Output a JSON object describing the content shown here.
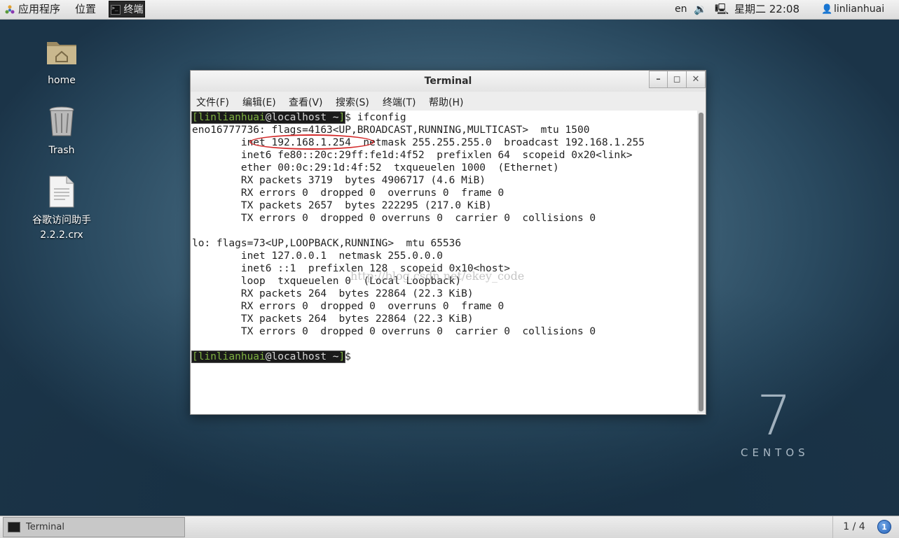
{
  "top_panel": {
    "applications": "应用程序",
    "places": "位置",
    "task_label": "终端",
    "language": "en",
    "clock": "星期二 22:08",
    "user": "linlianhuai",
    "icons": [
      "app-menu-icon",
      "terminal-icon",
      "volume-icon",
      "network-icon",
      "user-icon"
    ]
  },
  "desktop": {
    "icons": [
      {
        "label": "home",
        "icon": "home-folder-icon"
      },
      {
        "label": "Trash",
        "icon": "trash-icon"
      },
      {
        "label": "谷歌访问助手",
        "label2": "2.2.2.crx",
        "icon": "file-icon"
      }
    ],
    "brand_number": "7",
    "brand_name": "CENTOS"
  },
  "window": {
    "title": "Terminal",
    "buttons": [
      "minimize",
      "maximize",
      "close"
    ],
    "menu": [
      "文件(F)",
      "编辑(E)",
      "查看(V)",
      "搜索(S)",
      "终端(T)",
      "帮助(H)"
    ]
  },
  "terminal": {
    "prompt_user": "linlianhuai",
    "prompt_host": "@localhost ~",
    "prompt_command": " ifconfig",
    "lines": [
      "eno16777736: flags=4163<UP,BROADCAST,RUNNING,MULTICAST>  mtu 1500",
      "        inet 192.168.1.254  netmask 255.255.255.0  broadcast 192.168.1.255",
      "        inet6 fe80::20c:29ff:fe1d:4f52  prefixlen 64  scopeid 0x20<link>",
      "        ether 00:0c:29:1d:4f:52  txqueuelen 1000  (Ethernet)",
      "        RX packets 3719  bytes 4906717 (4.6 MiB)",
      "        RX errors 0  dropped 0  overruns 0  frame 0",
      "        TX packets 2657  bytes 222295 (217.0 KiB)",
      "        TX errors 0  dropped 0 overruns 0  carrier 0  collisions 0",
      "",
      "lo: flags=73<UP,LOOPBACK,RUNNING>  mtu 65536",
      "        inet 127.0.0.1  netmask 255.0.0.0",
      "        inet6 ::1  prefixlen 128  scopeid 0x10<host>",
      "        loop  txqueuelen 0  (Local Loopback)",
      "        RX packets 264  bytes 22864 (22.3 KiB)",
      "        RX errors 0  dropped 0  overruns 0  frame 0",
      "        TX packets 264  bytes 22864 (22.3 KiB)",
      "        TX errors 0  dropped 0 overruns 0  carrier 0  collisions 0"
    ],
    "watermark": "http://blog.csdn.net/ekey_code",
    "highlight_color": "#d42a2a"
  },
  "bottom_panel": {
    "task_label": "Terminal",
    "pager": "1 / 4",
    "notification_count": "1"
  },
  "colors": {
    "prompt_user": "#7fb241",
    "panel_bg": "#e6e6e6",
    "desktop_bg": "#3f6278"
  }
}
